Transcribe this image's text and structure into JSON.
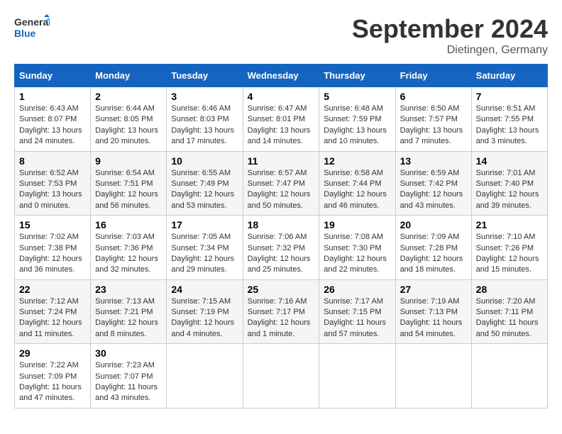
{
  "header": {
    "logo_line1": "General",
    "logo_line2": "Blue",
    "month_title": "September 2024",
    "location": "Dietingen, Germany"
  },
  "columns": [
    "Sunday",
    "Monday",
    "Tuesday",
    "Wednesday",
    "Thursday",
    "Friday",
    "Saturday"
  ],
  "weeks": [
    [
      {
        "day": "1",
        "sunrise": "Sunrise: 6:43 AM",
        "sunset": "Sunset: 8:07 PM",
        "daylight": "Daylight: 13 hours and 24 minutes."
      },
      {
        "day": "2",
        "sunrise": "Sunrise: 6:44 AM",
        "sunset": "Sunset: 8:05 PM",
        "daylight": "Daylight: 13 hours and 20 minutes."
      },
      {
        "day": "3",
        "sunrise": "Sunrise: 6:46 AM",
        "sunset": "Sunset: 8:03 PM",
        "daylight": "Daylight: 13 hours and 17 minutes."
      },
      {
        "day": "4",
        "sunrise": "Sunrise: 6:47 AM",
        "sunset": "Sunset: 8:01 PM",
        "daylight": "Daylight: 13 hours and 14 minutes."
      },
      {
        "day": "5",
        "sunrise": "Sunrise: 6:48 AM",
        "sunset": "Sunset: 7:59 PM",
        "daylight": "Daylight: 13 hours and 10 minutes."
      },
      {
        "day": "6",
        "sunrise": "Sunrise: 6:50 AM",
        "sunset": "Sunset: 7:57 PM",
        "daylight": "Daylight: 13 hours and 7 minutes."
      },
      {
        "day": "7",
        "sunrise": "Sunrise: 6:51 AM",
        "sunset": "Sunset: 7:55 PM",
        "daylight": "Daylight: 13 hours and 3 minutes."
      }
    ],
    [
      {
        "day": "8",
        "sunrise": "Sunrise: 6:52 AM",
        "sunset": "Sunset: 7:53 PM",
        "daylight": "Daylight: 13 hours and 0 minutes."
      },
      {
        "day": "9",
        "sunrise": "Sunrise: 6:54 AM",
        "sunset": "Sunset: 7:51 PM",
        "daylight": "Daylight: 12 hours and 56 minutes."
      },
      {
        "day": "10",
        "sunrise": "Sunrise: 6:55 AM",
        "sunset": "Sunset: 7:49 PM",
        "daylight": "Daylight: 12 hours and 53 minutes."
      },
      {
        "day": "11",
        "sunrise": "Sunrise: 6:57 AM",
        "sunset": "Sunset: 7:47 PM",
        "daylight": "Daylight: 12 hours and 50 minutes."
      },
      {
        "day": "12",
        "sunrise": "Sunrise: 6:58 AM",
        "sunset": "Sunset: 7:44 PM",
        "daylight": "Daylight: 12 hours and 46 minutes."
      },
      {
        "day": "13",
        "sunrise": "Sunrise: 6:59 AM",
        "sunset": "Sunset: 7:42 PM",
        "daylight": "Daylight: 12 hours and 43 minutes."
      },
      {
        "day": "14",
        "sunrise": "Sunrise: 7:01 AM",
        "sunset": "Sunset: 7:40 PM",
        "daylight": "Daylight: 12 hours and 39 minutes."
      }
    ],
    [
      {
        "day": "15",
        "sunrise": "Sunrise: 7:02 AM",
        "sunset": "Sunset: 7:38 PM",
        "daylight": "Daylight: 12 hours and 36 minutes."
      },
      {
        "day": "16",
        "sunrise": "Sunrise: 7:03 AM",
        "sunset": "Sunset: 7:36 PM",
        "daylight": "Daylight: 12 hours and 32 minutes."
      },
      {
        "day": "17",
        "sunrise": "Sunrise: 7:05 AM",
        "sunset": "Sunset: 7:34 PM",
        "daylight": "Daylight: 12 hours and 29 minutes."
      },
      {
        "day": "18",
        "sunrise": "Sunrise: 7:06 AM",
        "sunset": "Sunset: 7:32 PM",
        "daylight": "Daylight: 12 hours and 25 minutes."
      },
      {
        "day": "19",
        "sunrise": "Sunrise: 7:08 AM",
        "sunset": "Sunset: 7:30 PM",
        "daylight": "Daylight: 12 hours and 22 minutes."
      },
      {
        "day": "20",
        "sunrise": "Sunrise: 7:09 AM",
        "sunset": "Sunset: 7:28 PM",
        "daylight": "Daylight: 12 hours and 18 minutes."
      },
      {
        "day": "21",
        "sunrise": "Sunrise: 7:10 AM",
        "sunset": "Sunset: 7:26 PM",
        "daylight": "Daylight: 12 hours and 15 minutes."
      }
    ],
    [
      {
        "day": "22",
        "sunrise": "Sunrise: 7:12 AM",
        "sunset": "Sunset: 7:24 PM",
        "daylight": "Daylight: 12 hours and 11 minutes."
      },
      {
        "day": "23",
        "sunrise": "Sunrise: 7:13 AM",
        "sunset": "Sunset: 7:21 PM",
        "daylight": "Daylight: 12 hours and 8 minutes."
      },
      {
        "day": "24",
        "sunrise": "Sunrise: 7:15 AM",
        "sunset": "Sunset: 7:19 PM",
        "daylight": "Daylight: 12 hours and 4 minutes."
      },
      {
        "day": "25",
        "sunrise": "Sunrise: 7:16 AM",
        "sunset": "Sunset: 7:17 PM",
        "daylight": "Daylight: 12 hours and 1 minute."
      },
      {
        "day": "26",
        "sunrise": "Sunrise: 7:17 AM",
        "sunset": "Sunset: 7:15 PM",
        "daylight": "Daylight: 11 hours and 57 minutes."
      },
      {
        "day": "27",
        "sunrise": "Sunrise: 7:19 AM",
        "sunset": "Sunset: 7:13 PM",
        "daylight": "Daylight: 11 hours and 54 minutes."
      },
      {
        "day": "28",
        "sunrise": "Sunrise: 7:20 AM",
        "sunset": "Sunset: 7:11 PM",
        "daylight": "Daylight: 11 hours and 50 minutes."
      }
    ],
    [
      {
        "day": "29",
        "sunrise": "Sunrise: 7:22 AM",
        "sunset": "Sunset: 7:09 PM",
        "daylight": "Daylight: 11 hours and 47 minutes."
      },
      {
        "day": "30",
        "sunrise": "Sunrise: 7:23 AM",
        "sunset": "Sunset: 7:07 PM",
        "daylight": "Daylight: 11 hours and 43 minutes."
      },
      null,
      null,
      null,
      null,
      null
    ]
  ]
}
